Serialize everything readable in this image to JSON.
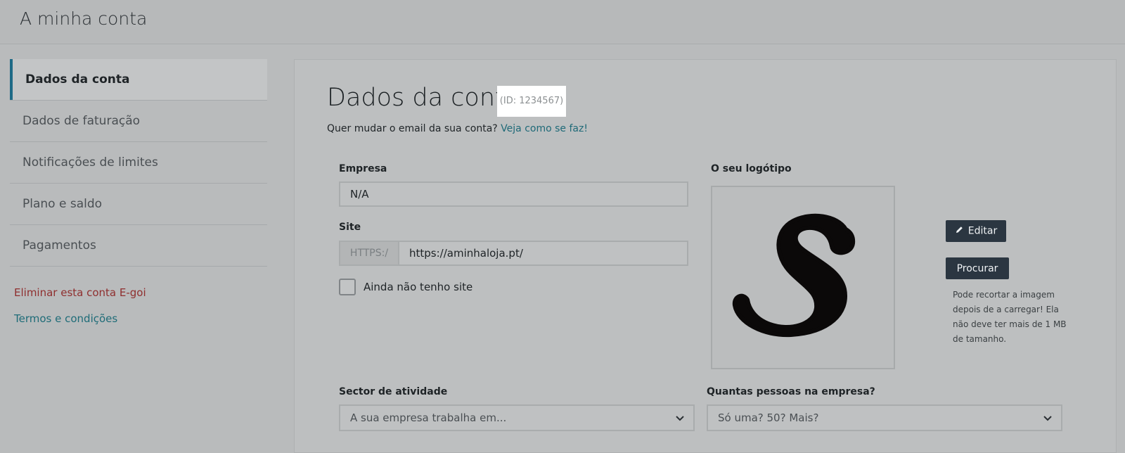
{
  "app": {
    "title": "A minha conta"
  },
  "sidebar": {
    "items": [
      {
        "label": "Dados da conta",
        "active": true
      },
      {
        "label": "Dados de faturação"
      },
      {
        "label": "Notificações de limites"
      },
      {
        "label": "Plano e saldo"
      },
      {
        "label": "Pagamentos"
      }
    ],
    "delete_link": "Eliminar esta conta E-goi",
    "terms_link": "Termos e condições"
  },
  "main": {
    "title": "Dados da conta",
    "id_badge": "(ID: 1234567)",
    "email_question": "Quer mudar o email da sua conta?",
    "email_link": "Veja como se faz!",
    "company": {
      "label": "Empresa",
      "value": "N/A"
    },
    "site": {
      "label": "Site",
      "prefix": "HTTPS:/",
      "value": "https://aminhaloja.pt/"
    },
    "no_site_checkbox": {
      "label": "Ainda não tenho site",
      "checked": false
    },
    "logo": {
      "label": "O seu logótipo",
      "edit_button": "Editar",
      "browse_button": "Procurar",
      "hint": "Pode recortar a imagem depois de a carregar! Ela não deve ter mais de 1 MB de tamanho."
    },
    "sector": {
      "label": "Sector de atividade",
      "placeholder": "A sua empresa trabalha em..."
    },
    "company_size": {
      "label": "Quantas pessoas na empresa?",
      "placeholder": "Só uma? 50? Mais?"
    }
  },
  "colors": {
    "accent": "#1e6a86",
    "link": "#1f6a78",
    "danger": "#8f2f2f",
    "button": "#2b3641"
  },
  "icons": {
    "edit": "pencil-icon",
    "dropdown": "chevron-down-icon"
  }
}
